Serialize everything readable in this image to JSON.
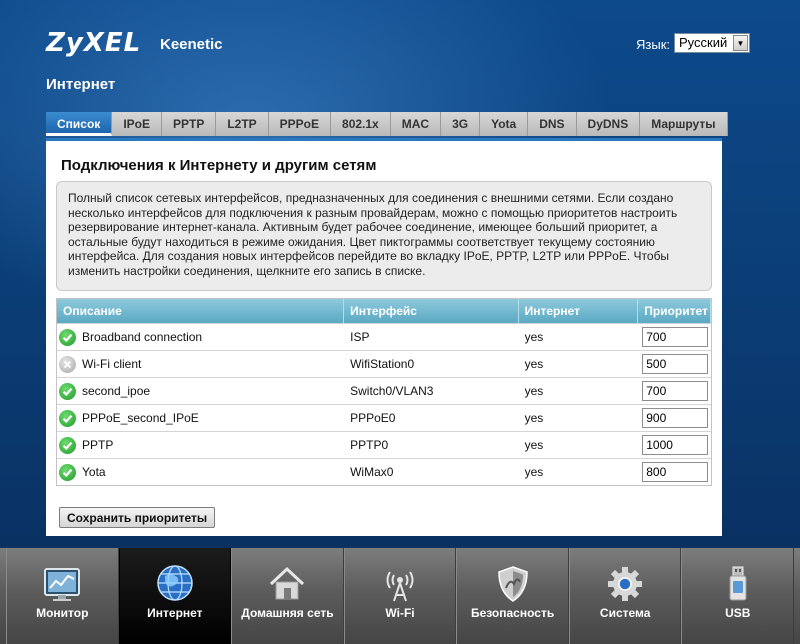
{
  "header": {
    "logo": "ZyXEL",
    "product": "Keenetic",
    "language_label": "Язык:",
    "language_value": "Русский"
  },
  "page_title": "Интернет",
  "tabs": [
    {
      "label": "Список",
      "active": true
    },
    {
      "label": "IPoE"
    },
    {
      "label": "PPTP"
    },
    {
      "label": "L2TP"
    },
    {
      "label": "PPPoE"
    },
    {
      "label": "802.1x"
    },
    {
      "label": "MAC"
    },
    {
      "label": "3G"
    },
    {
      "label": "Yota"
    },
    {
      "label": "DNS"
    },
    {
      "label": "DyDNS"
    },
    {
      "label": "Маршруты"
    }
  ],
  "panel": {
    "title": "Подключения к Интернету и другим сетям",
    "info_lines": [
      "Полный список сетевых интерфейсов, предназначенных для соединения с внешними сетями. Если создано",
      "несколько интерфейсов для подключения к разным провайдерам, можно с помощью приоритетов настроить",
      "резервирование интернет-канала. Активным будет рабочее соединение, имеющее больший приоритет, а",
      "остальные будут находиться в режиме ожидания. Цвет пиктограммы соответствует текущему состоянию",
      "интерфейса. Для создания новых интерфейсов перейдите во вкладку IPoE, PPTP, L2TP или PPPoE. Чтобы",
      "изменить настройки соединения, щелкните его запись в списке."
    ]
  },
  "table": {
    "headers": {
      "description": "Описание",
      "interface": "Интерфейс",
      "internet": "Интернет",
      "priority": "Приоритет"
    },
    "rows": [
      {
        "status": "ok",
        "description": "Broadband connection",
        "interface": "ISP",
        "internet": "yes",
        "priority": "700"
      },
      {
        "status": "off",
        "description": "Wi-Fi client",
        "interface": "WifiStation0",
        "internet": "yes",
        "priority": "500"
      },
      {
        "status": "ok",
        "description": "second_ipoe",
        "interface": "Switch0/VLAN3",
        "internet": "yes",
        "priority": "700"
      },
      {
        "status": "ok",
        "description": "PPPoE_second_IPoE",
        "interface": "PPPoE0",
        "internet": "yes",
        "priority": "900"
      },
      {
        "status": "ok",
        "description": "PPTP",
        "interface": "PPTP0",
        "internet": "yes",
        "priority": "1000"
      },
      {
        "status": "ok",
        "description": "Yota",
        "interface": "WiMax0",
        "internet": "yes",
        "priority": "800"
      }
    ]
  },
  "save_button": "Сохранить приоритеты",
  "nav": [
    {
      "label": "Монитор",
      "icon": "monitor-icon"
    },
    {
      "label": "Интернет",
      "icon": "globe-icon",
      "active": true
    },
    {
      "label": "Домашняя сеть",
      "icon": "home-icon"
    },
    {
      "label": "Wi-Fi",
      "icon": "wifi-antenna-icon"
    },
    {
      "label": "Безопасность",
      "icon": "shield-icon"
    },
    {
      "label": "Система",
      "icon": "gear-icon"
    },
    {
      "label": "USB",
      "icon": "usb-stick-icon"
    }
  ],
  "colors": {
    "accent": "#2a78c0",
    "status_ok": "#2bb33a",
    "status_off": "#b5b5b5",
    "table_header": "#6fb6cf"
  }
}
